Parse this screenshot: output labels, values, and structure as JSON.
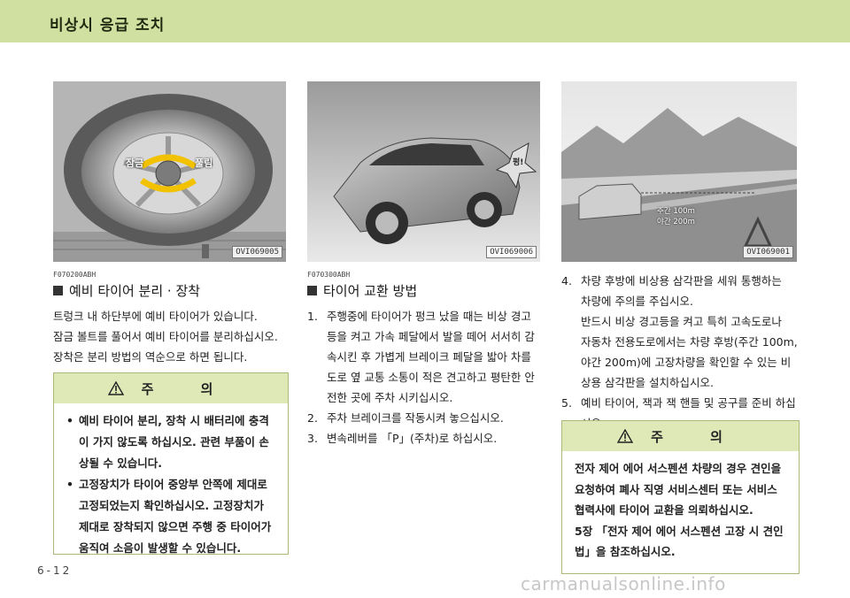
{
  "header": {
    "title": "비상시 응급 조치",
    "color": "#cfe0a0"
  },
  "left": {
    "image_code": "OVI069005",
    "image_labels": {
      "loosen": "잠금",
      "fasten": "풀림"
    },
    "doc_code": "F070200ABH",
    "title": "예비 타이어 분리 · 장착",
    "paragraph": [
      "트렁크 내 하단부에 예비 타이어가 있습니다.",
      "잠금 볼트를 풀어서 예비 타이어를 분리하십시오.",
      "장착은 분리 방법의 역순으로 하면 됩니다."
    ],
    "caution": {
      "title": "주 의",
      "items": [
        [
          "•",
          "예비 타이어 분리, 장착 시 배터리에 충격",
          "이 가지 않도록 하십시오. 관련 부품이 손",
          "상될 수 있습니다."
        ],
        [
          "•",
          "고정장치가 타이어 중앙부 안쪽에 제대로",
          "고정되었는지 확인하십시오. 고정장치가",
          "제대로 장착되지 않으면 주행 중 타이어가",
          "움직여 소음이 발생할 수 있습니다."
        ]
      ]
    }
  },
  "middle": {
    "image_code": "OVI069006",
    "image_label": "펑!",
    "doc_code": "F070300ABH",
    "title": "타이어 교환 방법",
    "steps": [
      [
        "1.",
        "주행중에 타이어가 펑크 났을 때는 비상 경고",
        "등을 켜고 가속 페달에서 발을 떼어 서서히 감",
        "속시킨 후 가볍게 브레이크 페달을 밟아 차를",
        "도로 옆 교통 소통이 적은 견고하고 평탄한 안",
        "전한 곳에 주차 시키십시오."
      ],
      [
        "2.",
        "주차 브레이크를 작동시켜 놓으십시오."
      ],
      [
        "3.",
        "변속레버를 「P」(주차)로 하십시오."
      ]
    ]
  },
  "right": {
    "image_code": "OVI069001",
    "image_label_1": "주간 100m",
    "image_label_2": "야간 200m",
    "steps": [
      [
        "4.",
        "차량 후방에 비상용 삼각판을 세워 통행하는",
        "차량에 주의를 주십시오.",
        "반드시 비상 경고등을 켜고 특히 고속도로나",
        "자동차 전용도로에서는 차량 후방(주간 100m,",
        "야간 200m)에 고장차량을 확인할 수 있는 비",
        "상용 삼각판을 설치하십시오."
      ],
      [
        "5.",
        "예비 타이어, 잭과 잭 핸들 및 공구를 준비 하십",
        "시오."
      ]
    ],
    "caution": {
      "title": "주 의",
      "lines": [
        "전자 제어 에어 서스펜션 차량의 경우 견인을",
        "요청하여 폐사 직영 서비스센터 또는 서비스",
        "협력사에 타이어 교환을 의뢰하십시오.",
        "5장 「전자 제어 에어 서스펜션 고장 시 견인",
        "법」을 참조하십시오."
      ]
    }
  },
  "footer": {
    "page": "6-12",
    "watermark": "carmanualsonline.info"
  }
}
